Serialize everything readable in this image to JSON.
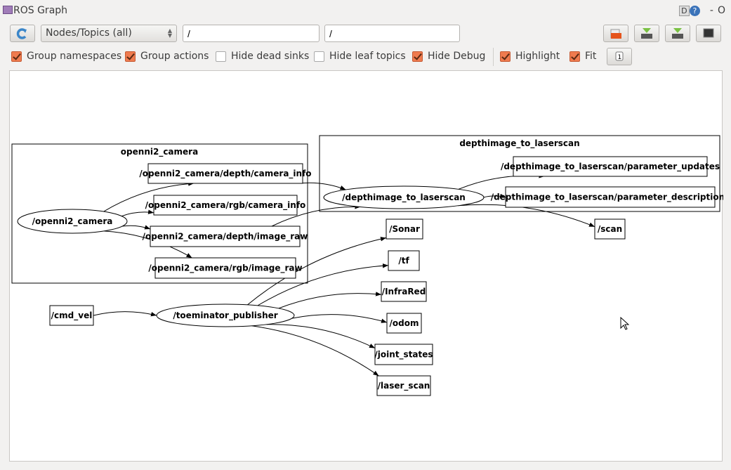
{
  "window": {
    "title": "ROS Graph",
    "debug_label": "D",
    "help_label": "?",
    "minimize": "-",
    "close": "O"
  },
  "toolbar": {
    "refresh_icon": "refresh-icon",
    "mode": "Nodes/Topics (all)",
    "node_filter": "/",
    "topic_filter": "/",
    "buttons": [
      "load-dot-icon",
      "save-dot-icon",
      "save-svg-icon",
      "save-image-icon"
    ]
  },
  "options": [
    {
      "label": "Group namespaces",
      "checked": true
    },
    {
      "label": "Group actions",
      "checked": true
    },
    {
      "label": "Hide dead sinks",
      "checked": false
    },
    {
      "label": "Hide leaf topics",
      "checked": false
    },
    {
      "label": "Hide Debug",
      "checked": true
    },
    {
      "label": "Highlight",
      "checked": true
    },
    {
      "label": "Fit",
      "checked": true
    }
  ],
  "fit_button_icon": "fit-in-view-icon",
  "graph": {
    "clusters": [
      {
        "id": "c1",
        "label": "openni2_camera"
      },
      {
        "id": "c2",
        "label": "depthimage_to_laserscan"
      }
    ],
    "nodes": [
      {
        "id": "n_cam",
        "label": "/openni2_camera",
        "shape": "ellipse"
      },
      {
        "id": "t_dci",
        "label": "/openni2_camera/depth/camera_info",
        "shape": "box"
      },
      {
        "id": "t_rci",
        "label": "/openni2_camera/rgb/camera_info",
        "shape": "box"
      },
      {
        "id": "t_dir",
        "label": "/openni2_camera/depth/image_raw",
        "shape": "box"
      },
      {
        "id": "t_rir",
        "label": "/openni2_camera/rgb/image_raw",
        "shape": "box"
      },
      {
        "id": "n_d2l",
        "label": "/depthimage_to_laserscan",
        "shape": "ellipse"
      },
      {
        "id": "t_pu",
        "label": "/depthimage_to_laserscan/parameter_updates",
        "shape": "box"
      },
      {
        "id": "t_pd",
        "label": "/depthimage_to_laserscan/parameter_descriptions",
        "shape": "box"
      },
      {
        "id": "t_scan",
        "label": "/scan",
        "shape": "box"
      },
      {
        "id": "t_sonar",
        "label": "/Sonar",
        "shape": "box"
      },
      {
        "id": "t_tf",
        "label": "/tf",
        "shape": "box"
      },
      {
        "id": "t_ir",
        "label": "/InfraRed",
        "shape": "box"
      },
      {
        "id": "t_odom",
        "label": "/odom",
        "shape": "box"
      },
      {
        "id": "t_js",
        "label": "/joint_states",
        "shape": "box"
      },
      {
        "id": "t_ls",
        "label": "/laser_scan",
        "shape": "box"
      },
      {
        "id": "t_cmd",
        "label": "/cmd_vel",
        "shape": "box"
      },
      {
        "id": "n_toe",
        "label": "/toeminator_publisher",
        "shape": "ellipse"
      }
    ],
    "edges": [
      [
        "n_cam",
        "t_dci"
      ],
      [
        "n_cam",
        "t_rci"
      ],
      [
        "n_cam",
        "t_dir"
      ],
      [
        "n_cam",
        "t_rir"
      ],
      [
        "t_dci",
        "n_d2l"
      ],
      [
        "t_dir",
        "n_d2l"
      ],
      [
        "n_d2l",
        "t_pu"
      ],
      [
        "n_d2l",
        "t_pd"
      ],
      [
        "n_d2l",
        "t_scan"
      ],
      [
        "t_cmd",
        "n_toe"
      ],
      [
        "n_toe",
        "t_sonar"
      ],
      [
        "n_toe",
        "t_tf"
      ],
      [
        "n_toe",
        "t_ir"
      ],
      [
        "n_toe",
        "t_odom"
      ],
      [
        "n_toe",
        "t_js"
      ],
      [
        "n_toe",
        "t_ls"
      ]
    ]
  }
}
